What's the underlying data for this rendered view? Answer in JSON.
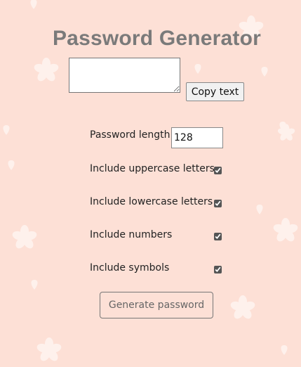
{
  "title": "Password Generator",
  "output": {
    "value": ""
  },
  "copy_button": {
    "label": "Copy text"
  },
  "options": {
    "length": {
      "label": "Password length",
      "value": "128"
    },
    "uppercase": {
      "label": "Include uppercase letters",
      "checked": true
    },
    "lowercase": {
      "label": "Include lowercase letters",
      "checked": true
    },
    "numbers": {
      "label": "Include numbers",
      "checked": true
    },
    "symbols": {
      "label": "Include symbols",
      "checked": true
    }
  },
  "generate_button": {
    "label": "Generate password"
  },
  "colors": {
    "background": "#fde0d6",
    "title": "#7a7a7a",
    "pattern": "#ffffff"
  }
}
